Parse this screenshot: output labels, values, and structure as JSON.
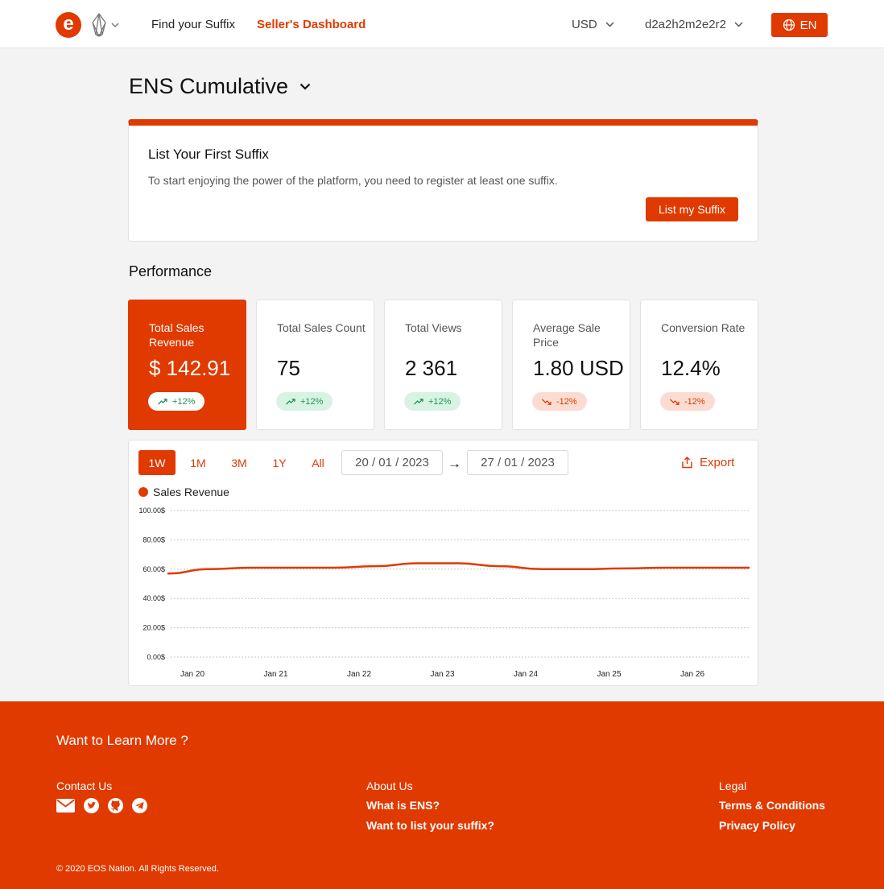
{
  "header": {
    "logo_letter": "e",
    "nav": {
      "find": "Find your Suffix",
      "dashboard": "Seller's Dashboard"
    },
    "currency": "USD",
    "account": "d2a2h2m2e2r2",
    "language": "EN",
    "brand_color": "#e03a00"
  },
  "page": {
    "title": "ENS Cumulative"
  },
  "banner": {
    "title": "List Your First Suffix",
    "text": "To start enjoying the power of the platform, you need to register at least one suffix.",
    "button": "List my Suffix"
  },
  "performance": {
    "title": "Performance",
    "metrics": [
      {
        "label": "Total Sales Revenue",
        "value": "$ 142.91",
        "change": "+12%",
        "trend": "up",
        "active": true
      },
      {
        "label": "Total Sales Count",
        "value": "75",
        "change": "+12%",
        "trend": "up",
        "active": false
      },
      {
        "label": "Total Views",
        "value": "2 361",
        "change": "+12%",
        "trend": "up",
        "active": false
      },
      {
        "label": "Average Sale Price",
        "value": "1.80 USD",
        "change": "-12%",
        "trend": "down",
        "active": false
      },
      {
        "label": "Conversion Rate",
        "value": "12.4%",
        "change": "-12%",
        "trend": "down",
        "active": false
      }
    ]
  },
  "chart_controls": {
    "ranges": [
      "1W",
      "1M",
      "3M",
      "1Y",
      "All"
    ],
    "selected_range": "1W",
    "date_from": "20 / 01 / 2023",
    "date_to": "27 / 01 / 2023",
    "arrow": "→",
    "export": "Export"
  },
  "chart_data": {
    "type": "line",
    "series": [
      {
        "name": "Sales Revenue",
        "color": "#e03a00",
        "x": [
          "Jan 20",
          "Jan 20.5",
          "Jan 21",
          "Jan 21.5",
          "Jan 22",
          "Jan 22.5",
          "Jan 23",
          "Jan 23.5",
          "Jan 24",
          "Jan 24.5",
          "Jan 25",
          "Jan 25.5",
          "Jan 26",
          "Jan 26.5",
          "Jan 27"
        ],
        "values": [
          57,
          60,
          61,
          61,
          61,
          62,
          64,
          64,
          62,
          60,
          60,
          60.5,
          61,
          61,
          61
        ]
      }
    ],
    "categories": [
      "Jan 20",
      "Jan 21",
      "Jan 22",
      "Jan 23",
      "Jan 24",
      "Jan 25",
      "Jan 26"
    ],
    "y_ticks": [
      "100.00$",
      "80.00$",
      "60.00$",
      "40.00$",
      "20.00$",
      "0.00$"
    ],
    "ylim": [
      0,
      100
    ],
    "grid": true,
    "legend": "top-left"
  },
  "footer": {
    "heading": "Want to Learn More ?",
    "contact_title": "Contact Us",
    "icons": [
      "mail-icon",
      "twitter-icon",
      "github-icon",
      "telegram-icon"
    ],
    "about_title": "About Us",
    "about_links": [
      "What is ENS?",
      "Want to list your suffix?"
    ],
    "legal_title": "Legal",
    "legal_links": [
      "Terms & Conditions",
      "Privacy Policy"
    ],
    "copyright": "© 2020 EOS Nation. All Rights Reserved."
  }
}
